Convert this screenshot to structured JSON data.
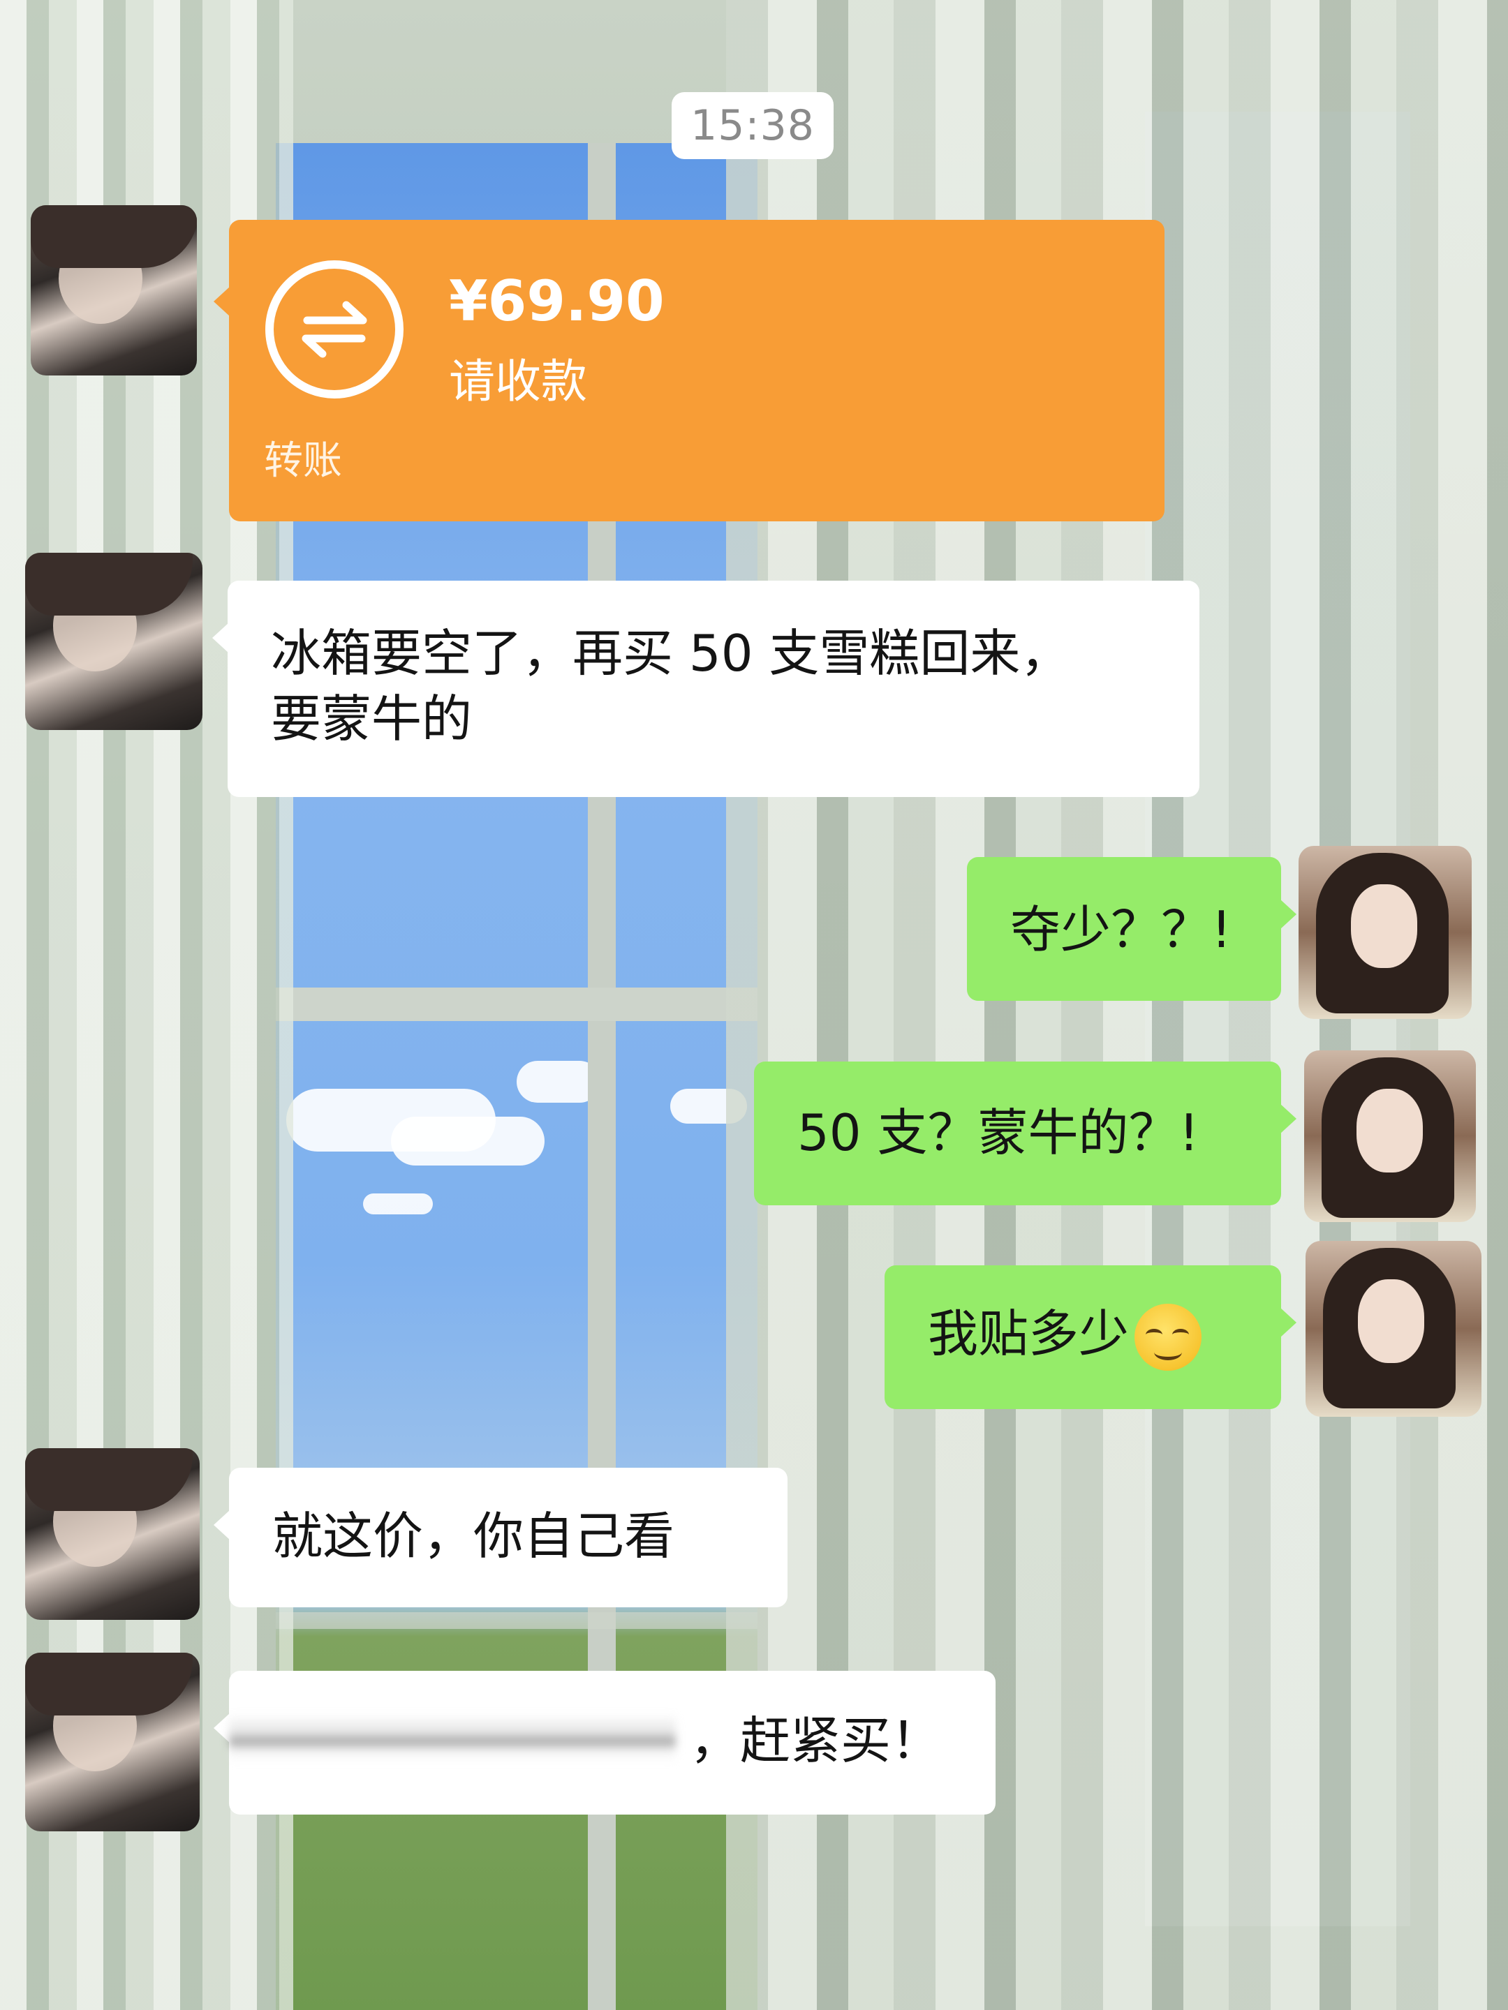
{
  "timestamp": "15:38",
  "transfer": {
    "amount": "¥69.90",
    "subtitle": "请收款",
    "label": "转账",
    "icon": "transfer-arrows-icon",
    "color": "#f89d36"
  },
  "messages": [
    {
      "sender": "other",
      "text_line1": "冰箱要空了，再买 50 支雪糕回来，",
      "text_line2": "要蒙牛的"
    },
    {
      "sender": "me",
      "text": "夺少？？!"
    },
    {
      "sender": "me",
      "text": "50 支？蒙牛的？!"
    },
    {
      "sender": "me",
      "text": "我贴多少",
      "emoji": "smirk-face-icon"
    },
    {
      "sender": "other",
      "text": "就这价，你自己看"
    },
    {
      "sender": "other",
      "text": "，赶紧买！",
      "redacted": true
    }
  ],
  "colors": {
    "bubble_green": "#95ec69",
    "bubble_white": "#ffffff",
    "transfer_orange": "#f89d36"
  }
}
